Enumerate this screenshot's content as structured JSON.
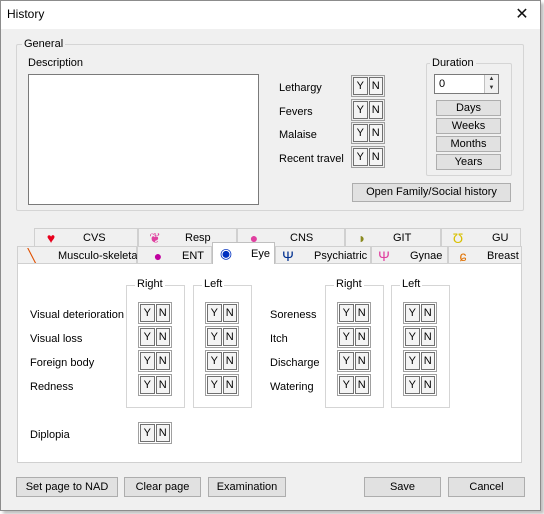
{
  "window": {
    "title": "History",
    "close_glyph": "✕"
  },
  "general": {
    "group_label": "General",
    "description_label": "Description",
    "description_value": "",
    "symptoms": [
      {
        "label": "Lethargy",
        "y": "Y",
        "n": "N"
      },
      {
        "label": "Fevers",
        "y": "Y",
        "n": "N"
      },
      {
        "label": "Malaise",
        "y": "Y",
        "n": "N"
      },
      {
        "label": "Recent travel",
        "y": "Y",
        "n": "N"
      }
    ],
    "duration": {
      "group_label": "Duration",
      "value": "0",
      "buttons": [
        "Days",
        "Weeks",
        "Months",
        "Years"
      ]
    },
    "family_button": "Open Family/Social history"
  },
  "tabs": {
    "row1": [
      {
        "label": "CVS",
        "icon": "heart-icon",
        "color": "#e8001c"
      },
      {
        "label": "Resp",
        "icon": "lungs-icon",
        "color": "#e040a0"
      },
      {
        "label": "CNS",
        "icon": "brain-icon",
        "color": "#e040a0"
      },
      {
        "label": "GIT",
        "icon": "stomach-icon",
        "color": "#8a8a20"
      },
      {
        "label": "GU",
        "icon": "kidney-icon",
        "color": "#d8c000"
      }
    ],
    "row2": [
      {
        "label": "Musculo-skeletal",
        "icon": "bone-icon",
        "color": "#e05000"
      },
      {
        "label": "ENT",
        "icon": "ear-icon",
        "color": "#c000a0"
      },
      {
        "label": "Eye",
        "icon": "eye-icon",
        "color": "#0030c0",
        "active": true
      },
      {
        "label": "Psychiatric",
        "icon": "psi-icon",
        "color": "#003090"
      },
      {
        "label": "Gynae",
        "icon": "uterus-icon",
        "color": "#e040a0"
      },
      {
        "label": "Breast",
        "icon": "breast-icon",
        "color": "#e07000"
      }
    ]
  },
  "eye": {
    "right_label": "Right",
    "left_label": "Left",
    "left_symptoms": [
      "Visual deterioration",
      "Visual loss",
      "Foreign body",
      "Redness"
    ],
    "right_symptoms": [
      "Soreness",
      "Itch",
      "Discharge",
      "Watering"
    ],
    "diplopia_label": "Diplopia",
    "y": "Y",
    "n": "N"
  },
  "footer": {
    "set_nad": "Set page to NAD",
    "clear": "Clear page",
    "examination": "Examination",
    "save": "Save",
    "cancel": "Cancel"
  }
}
